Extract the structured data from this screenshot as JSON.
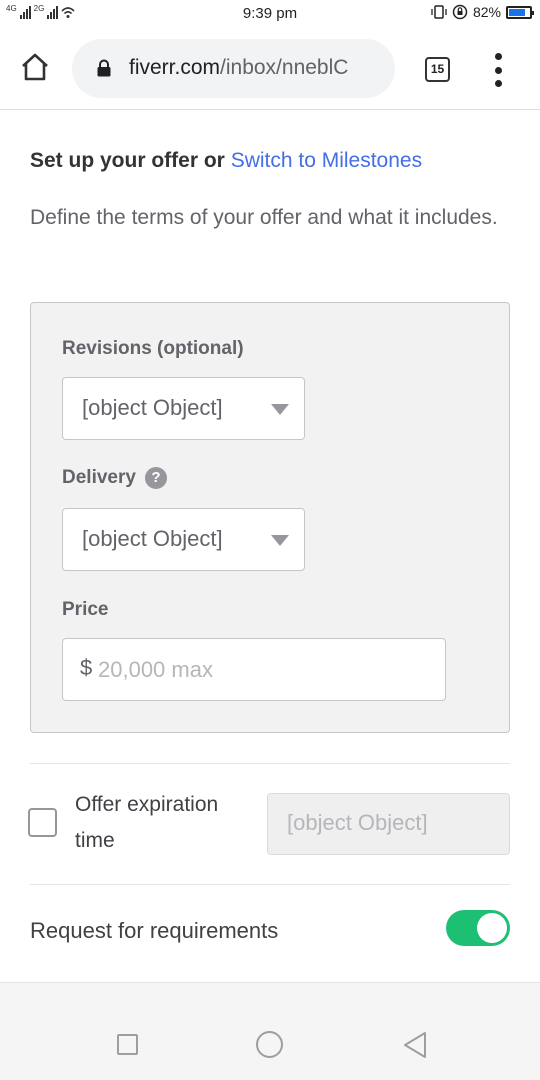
{
  "status_bar": {
    "network_1": "4G",
    "network_2": "2G",
    "time": "9:39 pm",
    "battery": "82%",
    "battery_level": 0.82
  },
  "browser": {
    "url_domain": "fiverr.com",
    "url_path": "/inbox/nneblC",
    "tab_count": "15"
  },
  "offer": {
    "heading_prefix": "Set up your offer or ",
    "heading_link": "Switch to Milestones",
    "description": "Define the terms of your offer and what it includes.",
    "revisions_label": "Revisions (optional)",
    "revisions_value": "[object Object]",
    "delivery_label": "Delivery",
    "delivery_help": "?",
    "delivery_value": "[object Object]",
    "price_label": "Price",
    "price_currency": "$",
    "price_placeholder": "20,000 max",
    "expiration_label": "Offer expiration time",
    "expiration_value": "[object Object]",
    "expiration_checked": false,
    "requirements_label": "Request for requirements",
    "requirements_enabled": true
  },
  "colors": {
    "link": "#446ee7",
    "toggle_on": "#1dbf73",
    "battery_fill": "#1a73e8"
  }
}
